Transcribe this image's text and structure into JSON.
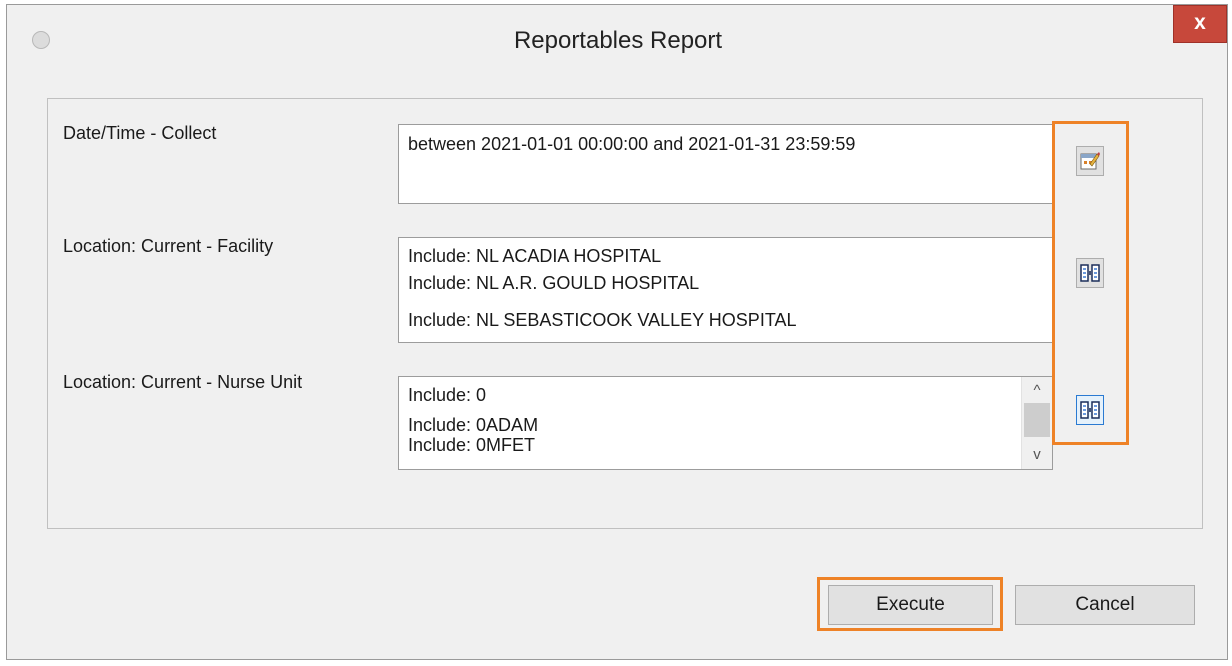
{
  "window": {
    "title": "Reportables Report",
    "close_label": "x"
  },
  "fields": [
    {
      "label": "Date/Time - Collect",
      "lines": [
        "between 2021-01-01 00:00:00 and 2021-01-31 23:59:59"
      ],
      "button_icon": "calendar-edit-icon"
    },
    {
      "label": "Location: Current - Facility",
      "lines": [
        "Include: NL ACADIA HOSPITAL",
        "Include: NL A.R. GOULD HOSPITAL",
        "Include: NL SEBASTICOOK VALLEY HOSPITAL"
      ],
      "button_icon": "list-select-icon"
    },
    {
      "label": "Location: Current - Nurse Unit",
      "lines": [
        "Include: 0",
        "Include: 0ADAM",
        "Include: 0MFET"
      ],
      "button_icon": "list-select-icon"
    }
  ],
  "scrollbar": {
    "up": "^",
    "down": "v"
  },
  "buttons": {
    "execute": "Execute",
    "cancel": "Cancel"
  },
  "colors": {
    "highlight": "#ee8227",
    "close_button": "#c7483b",
    "focus": "#2a7ad2"
  }
}
